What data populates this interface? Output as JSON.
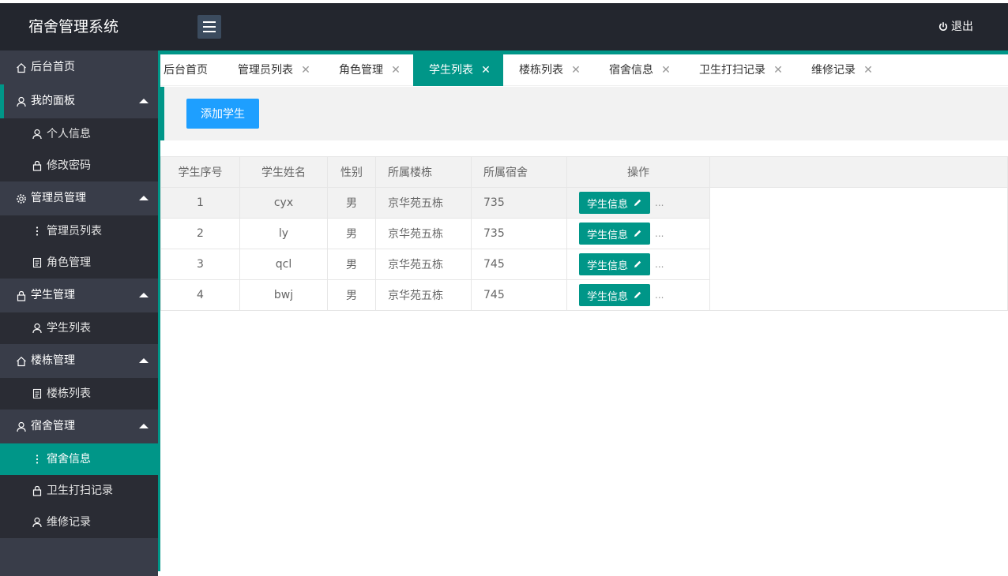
{
  "app": {
    "title": "宿舍管理系统",
    "logout_label": "退出"
  },
  "sidebar": {
    "home": "后台首页",
    "groups": [
      {
        "label": "我的面板",
        "items": [
          "个人信息",
          "修改密码"
        ]
      },
      {
        "label": "管理员管理",
        "items": [
          "管理员列表",
          "角色管理"
        ]
      },
      {
        "label": "学生管理",
        "items": [
          "学生列表"
        ]
      },
      {
        "label": "楼栋管理",
        "items": [
          "楼栋列表"
        ]
      },
      {
        "label": "宿舍管理",
        "items": [
          "宿舍信息",
          "卫生打扫记录",
          "维修记录"
        ]
      }
    ],
    "selected_item": "宿舍信息"
  },
  "tabs": [
    "后台首页",
    "管理员列表",
    "角色管理",
    "学生列表",
    "楼栋列表",
    "宿舍信息",
    "卫生打扫记录",
    "维修记录"
  ],
  "active_tab": "学生列表",
  "toolbar": {
    "add_label": "添加学生"
  },
  "table": {
    "headers": [
      "学生序号",
      "学生姓名",
      "性别",
      "所属楼栋",
      "所属宿舍",
      "操作"
    ],
    "rows": [
      {
        "num": "1",
        "name": "cyx",
        "sex": "男",
        "building": "京华苑五栋",
        "room": "735"
      },
      {
        "num": "2",
        "name": "ly",
        "sex": "男",
        "building": "京华苑五栋",
        "room": "735"
      },
      {
        "num": "3",
        "name": "qcl",
        "sex": "男",
        "building": "京华苑五栋",
        "room": "745"
      },
      {
        "num": "4",
        "name": "bwj",
        "sex": "男",
        "building": "京华苑五栋",
        "room": "745"
      }
    ],
    "action_label": "学生信息",
    "more_label": "..."
  },
  "colors": {
    "topbar": "#23262e",
    "sidebar": "#393d49",
    "accent": "#009688",
    "button_blue": "#1e9fff"
  }
}
